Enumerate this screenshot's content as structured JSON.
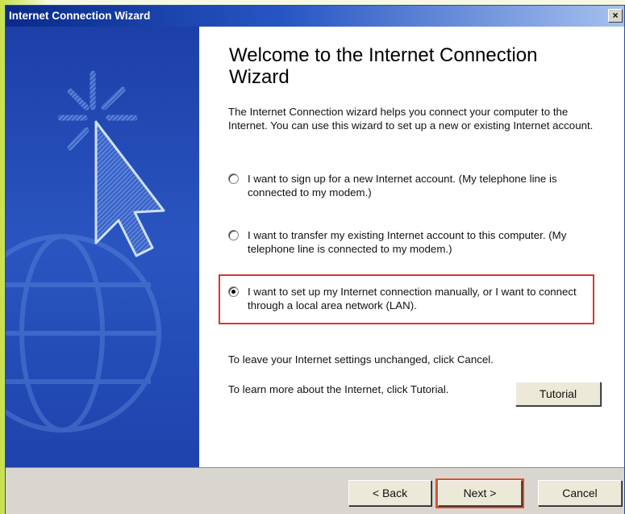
{
  "window": {
    "title": "Internet Connection Wizard",
    "close_glyph": "×"
  },
  "content": {
    "heading": "Welcome to the Internet Connection Wizard",
    "intro": "The Internet Connection wizard helps you connect your computer to the Internet.  You can use this wizard to set up a new or existing Internet account.",
    "options": [
      {
        "label": "I want to sign up for a new Internet account. (My telephone line is connected to my modem.)",
        "selected": false
      },
      {
        "label": "I want to transfer my existing Internet account to this computer. (My telephone line is connected to my modem.)",
        "selected": false
      },
      {
        "label": "I want to set up my Internet connection manually, or I want to connect through a local area network (LAN).",
        "selected": true
      }
    ],
    "leave_text": "To leave your Internet settings unchanged, click Cancel.",
    "learn_text": "To learn more about the Internet, click Tutorial.",
    "tutorial_label": "Tutorial"
  },
  "footer": {
    "back_label": "< Back",
    "next_label": "Next >",
    "cancel_label": "Cancel"
  },
  "colors": {
    "titlebar": "#0a2a8a",
    "left_panel": "#2a55c0",
    "highlight": "#d93535"
  },
  "icons": [
    "cursor-click-icon",
    "globe-icon",
    "radio-icon",
    "close-icon"
  ]
}
